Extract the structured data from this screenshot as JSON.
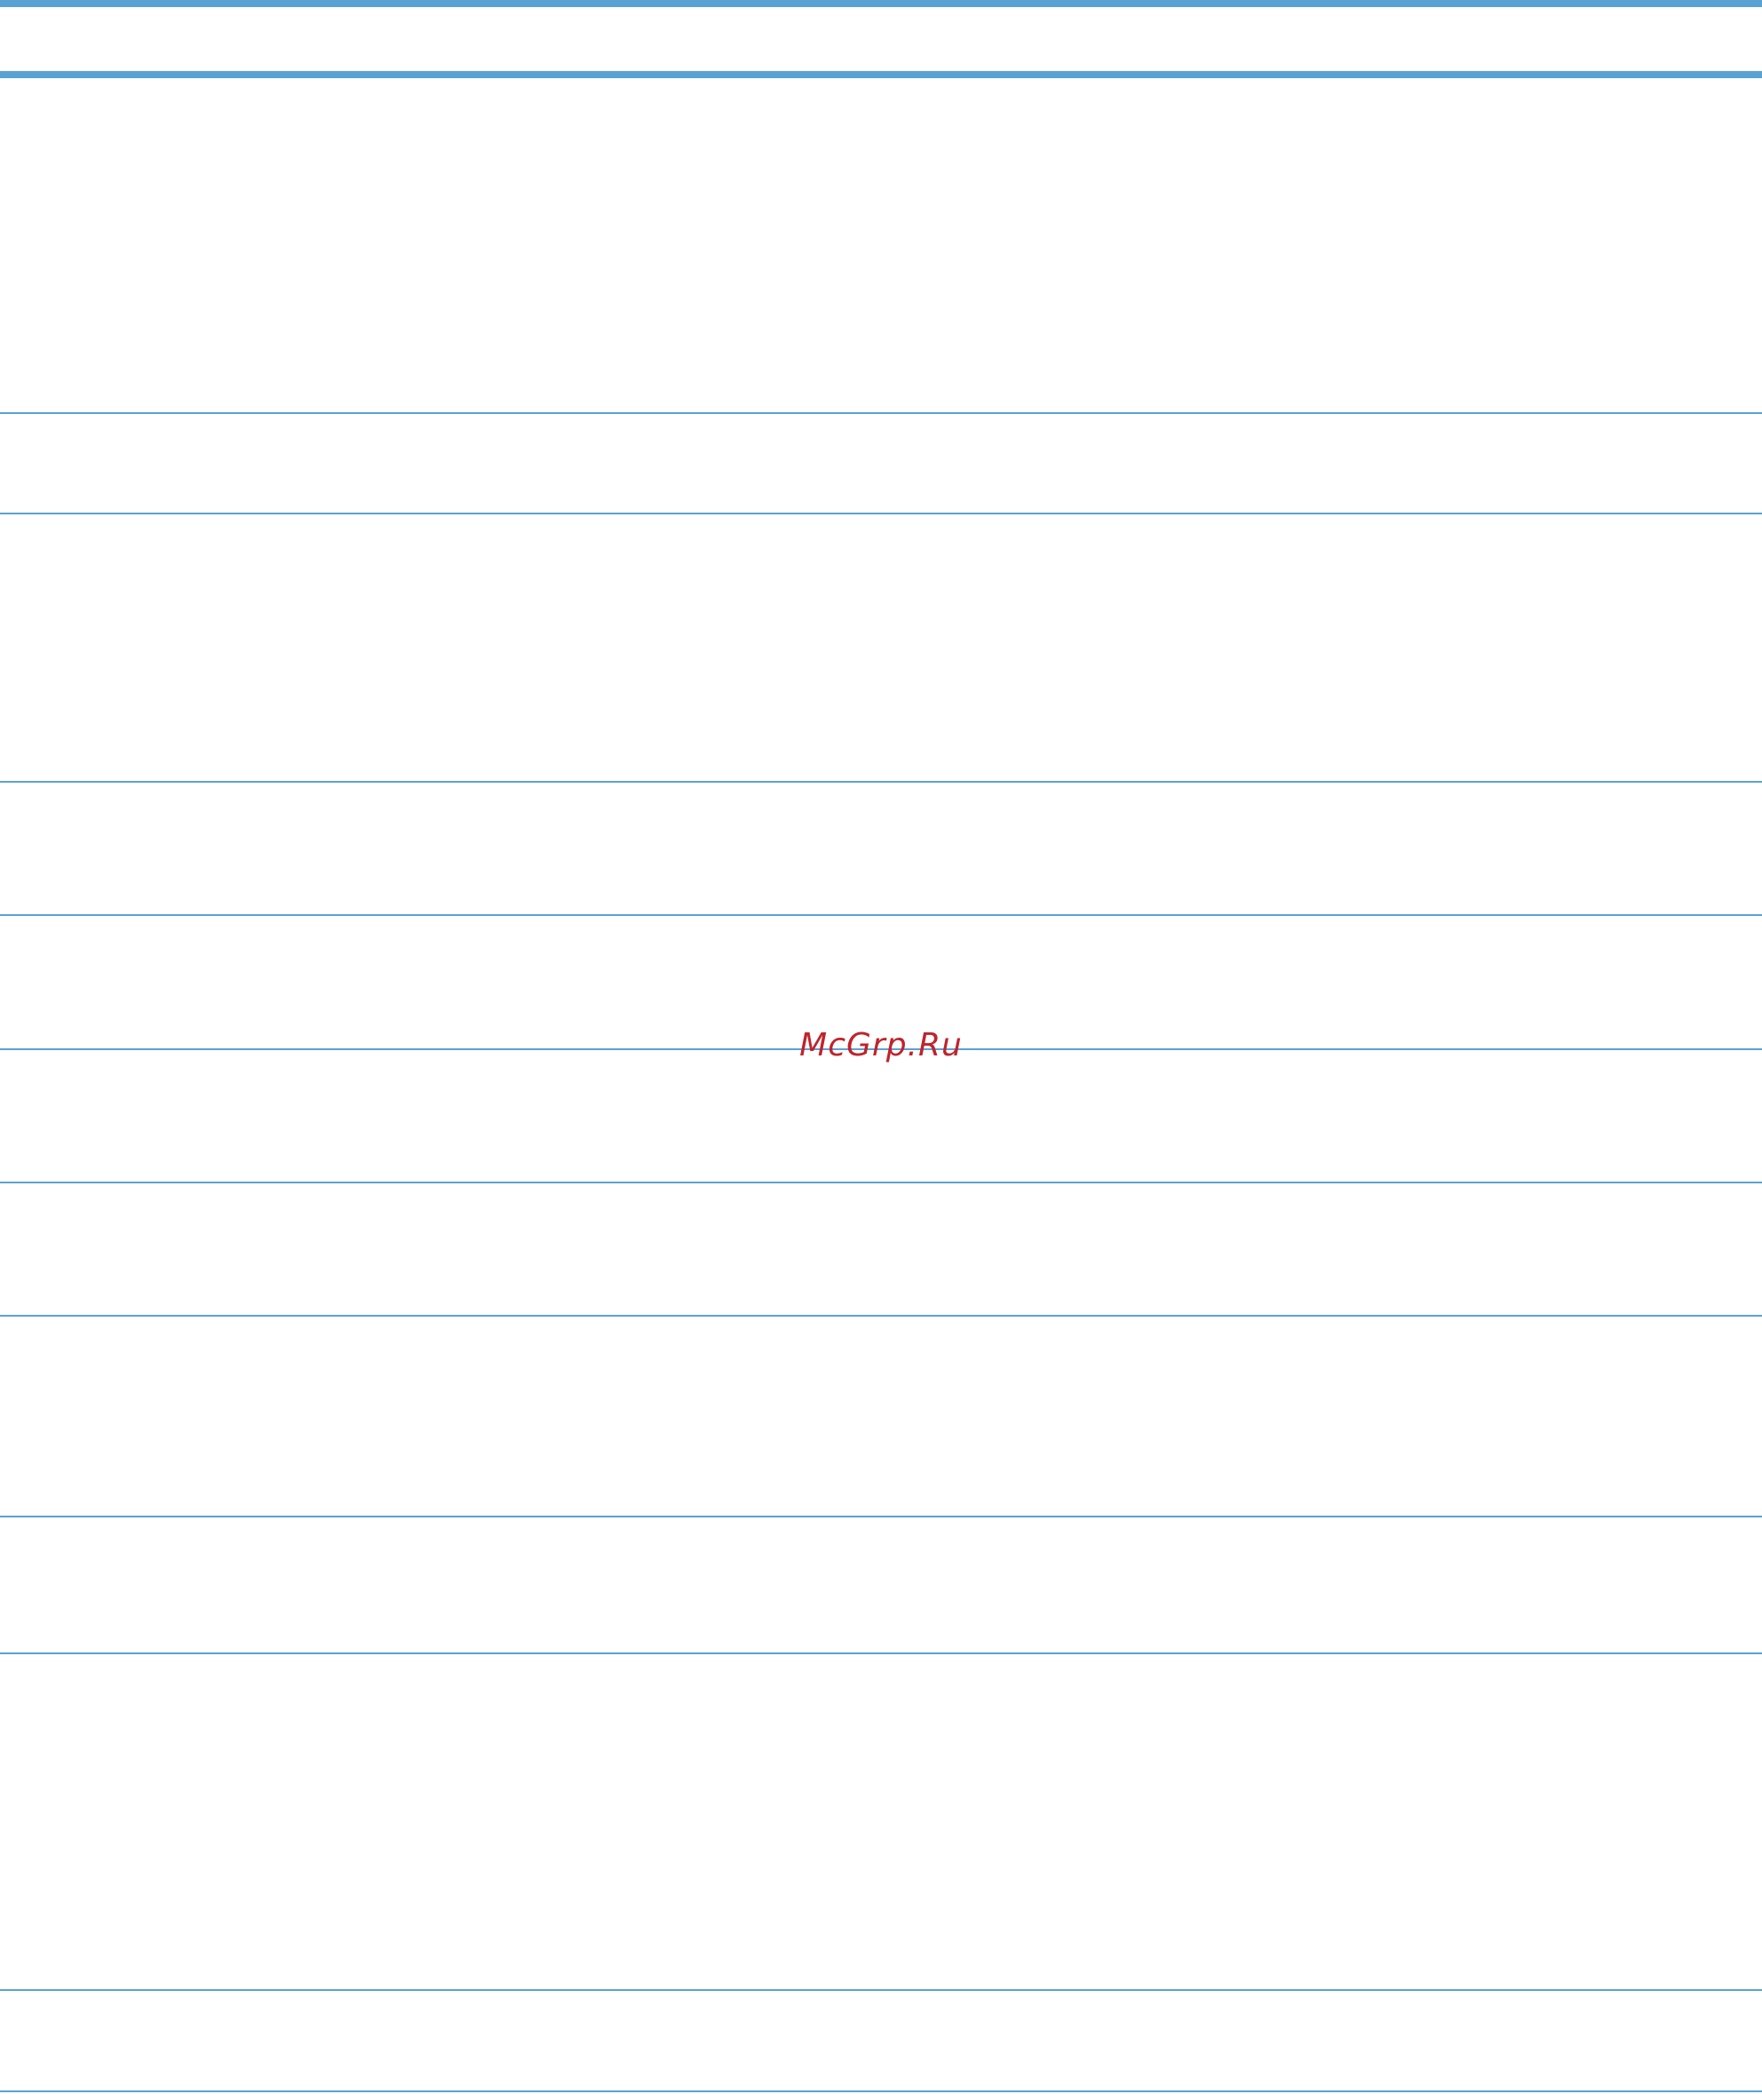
{
  "document": {
    "header_row": {
      "label": ""
    },
    "table_rows": [
      "",
      "",
      "",
      "",
      "",
      "",
      "",
      "",
      "",
      ""
    ]
  },
  "watermark": {
    "text": "McGrp.Ru",
    "color": "#c0232c"
  },
  "colors": {
    "rule": "#5aa2d3",
    "background": "#ffffff"
  }
}
